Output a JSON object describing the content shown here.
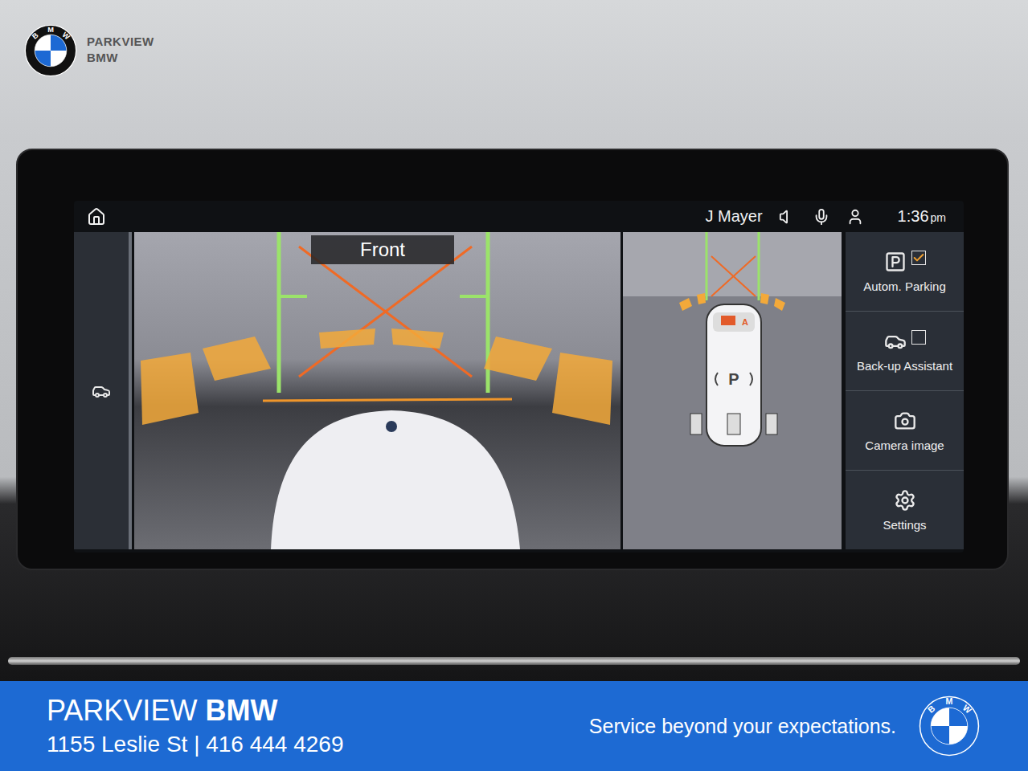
{
  "brand": {
    "name": "PARKVIEW",
    "sub": "BMW",
    "logo_letters": [
      "B",
      "M",
      "W"
    ]
  },
  "status_bar": {
    "user": "J Mayer",
    "time": "1:36",
    "ampm": "pm"
  },
  "camera": {
    "view_label": "Front"
  },
  "top_view": {
    "park_symbol": "P",
    "camera_badge": "A"
  },
  "menu": [
    {
      "label": "Autom. Parking",
      "kind": "checkbox",
      "checked": true
    },
    {
      "label": "Back-up Assistant",
      "kind": "checkbox",
      "checked": false
    },
    {
      "label": "Camera image",
      "kind": "action"
    },
    {
      "label": "Settings",
      "kind": "action"
    }
  ],
  "banner": {
    "name": "PARKVIEW",
    "name_bold": "BMW",
    "address": "1155 Leslie St | 416 444 4269",
    "tagline": "Service beyond your expectations."
  }
}
